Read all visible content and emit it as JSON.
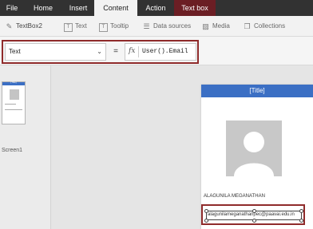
{
  "ribbon": {
    "tabs": [
      {
        "label": "File"
      },
      {
        "label": "Home"
      },
      {
        "label": "Insert"
      },
      {
        "label": "Content"
      },
      {
        "label": "Action"
      },
      {
        "label": "Text box"
      }
    ],
    "active_tab": "Content",
    "contextual_tab_color": "#6b1e24"
  },
  "commands": {
    "items": [
      {
        "label": "TextBox2",
        "icon": "edit-icon"
      },
      {
        "label": "Text",
        "icon": "text-icon"
      },
      {
        "label": "Tooltip",
        "icon": "tooltip-icon"
      },
      {
        "label": "Data sources",
        "icon": "database-icon"
      },
      {
        "label": "Media",
        "icon": "image-icon"
      },
      {
        "label": "Collections",
        "icon": "collections-icon"
      }
    ]
  },
  "formula": {
    "property": "Text",
    "equals": "=",
    "fx_label": "fx",
    "expression": "User().Email"
  },
  "screens": {
    "label": "Screen1",
    "thumb_title": "[Title]"
  },
  "app_preview": {
    "title": "[Title]",
    "name_text": "ALAGUNILA MEGANATHAN",
    "email_text": "alagunilameganathanpec@paavai.edu.in"
  },
  "colors": {
    "header_blue": "#3b6fc4",
    "highlight_red": "#8f2b2b",
    "ribbon_dark": "#323232"
  }
}
